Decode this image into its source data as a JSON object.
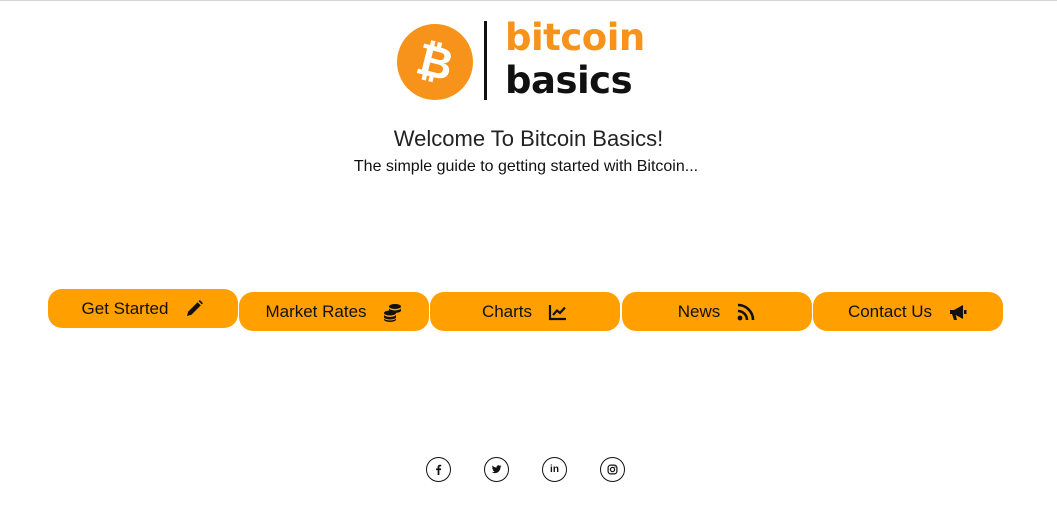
{
  "logo": {
    "word_top": "bitcoin",
    "word_bottom": "basics",
    "coin_symbol": "₿",
    "coin_icon": "bitcoin-coin-icon"
  },
  "hero": {
    "title": "Welcome To Bitcoin Basics!",
    "subtitle": "The simple guide to getting started with Bitcoin..."
  },
  "nav": {
    "items": [
      {
        "label": "Get Started",
        "icon": "pencil-icon"
      },
      {
        "label": "Market Rates",
        "icon": "coins-icon"
      },
      {
        "label": "Charts",
        "icon": "line-chart-icon"
      },
      {
        "label": "News",
        "icon": "rss-icon"
      },
      {
        "label": "Contact Us",
        "icon": "megaphone-icon"
      }
    ]
  },
  "social": {
    "items": [
      {
        "icon": "facebook-icon"
      },
      {
        "icon": "twitter-icon"
      },
      {
        "icon": "linkedin-icon",
        "text": "in"
      },
      {
        "icon": "instagram-icon"
      }
    ]
  },
  "colors": {
    "accent": "#ff9f00",
    "brand_orange": "#f7931a",
    "text": "#111111",
    "background": "#ffffff"
  }
}
